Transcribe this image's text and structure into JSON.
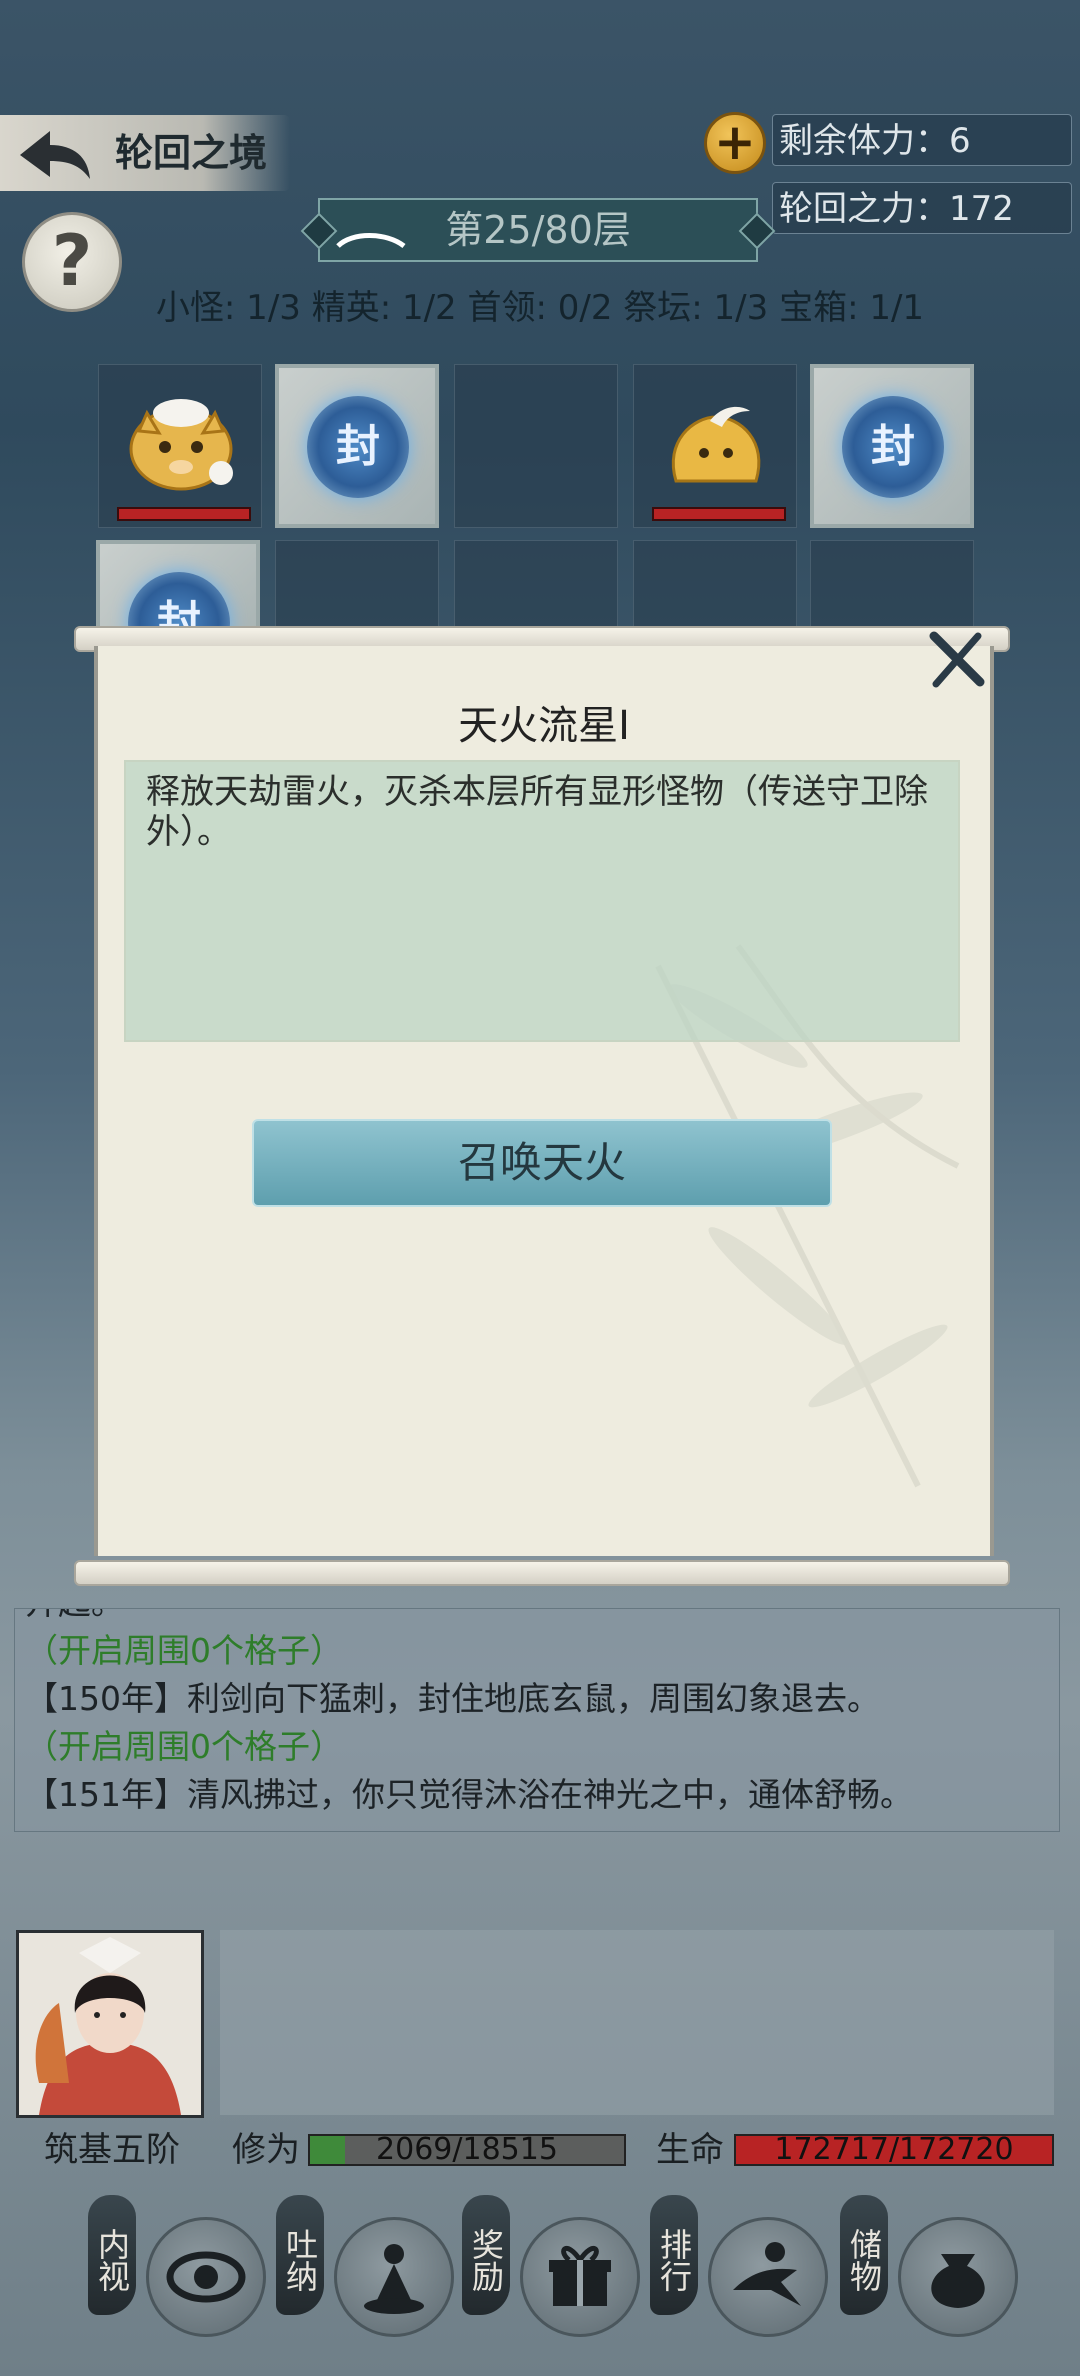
{
  "header": {
    "title": "轮回之境",
    "stamina_label": "剩余体力：6",
    "power_label": "轮回之力：172",
    "level_label": "第25/80层"
  },
  "counts_text": "小怪: 1/3  精英: 1/2  首领: 0/2  祭坛: 1/3  宝箱: 1/1",
  "grid": {
    "seal_char": "封"
  },
  "modal": {
    "title": "天火流星I",
    "description": "释放天劫雷火，灭杀本层所有显形怪物（传送守卫除外）。",
    "button_label": "召唤天火"
  },
  "log": {
    "partial": "开起。",
    "lines": [
      "（开启周围0个格子）",
      "【150年】利剑向下猛刺，封住地底玄鼠，周围幻象退去。",
      "（开启周围0个格子）",
      "【151年】清风拂过，你只觉得沐浴在神光之中，通体舒畅。"
    ]
  },
  "player": {
    "realm": "筑基五阶",
    "cultivation_label": "修为",
    "cultivation_value": "2069/18515",
    "cultivation_fraction": 0.112,
    "life_label": "生命",
    "life_value": "172717/172720",
    "life_fraction": 1.0
  },
  "nav": [
    {
      "label": "内视",
      "icon": "eye-icon"
    },
    {
      "label": "吐纳",
      "icon": "meditate-icon"
    },
    {
      "label": "奖励",
      "icon": "gift-icon"
    },
    {
      "label": "排行",
      "icon": "ranking-icon"
    },
    {
      "label": "储物",
      "icon": "bag-icon"
    }
  ],
  "colors": {
    "accent_green": "#2e7d2a",
    "hp_red": "#b82324",
    "cultivation_green": "#3f8a3a"
  }
}
